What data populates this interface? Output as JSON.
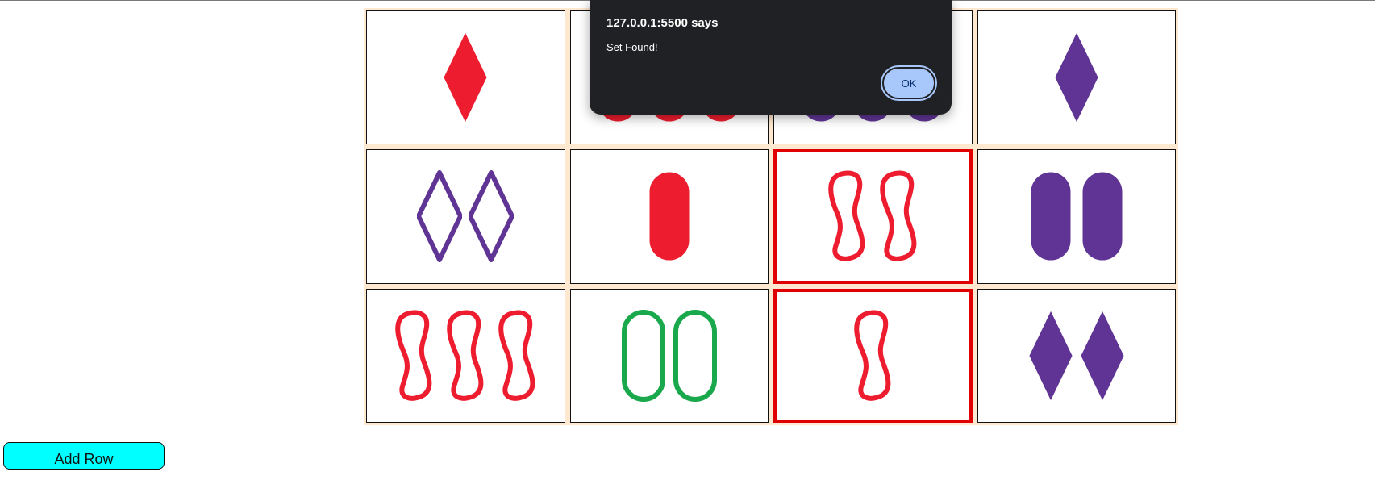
{
  "dialog": {
    "title": "127.0.0.1:5500 says",
    "message": "Set Found!",
    "ok_label": "OK"
  },
  "board": {
    "cards": [
      {
        "count": 1,
        "shape": "diamond",
        "color": "#ed1c2e",
        "fill": "solid",
        "selected": false
      },
      {
        "count": 3,
        "shape": "oval",
        "color": "#ed1c2e",
        "fill": "solid",
        "selected": false
      },
      {
        "count": 3,
        "shape": "oval",
        "color": "#5f3494",
        "fill": "solid",
        "selected": false
      },
      {
        "count": 1,
        "shape": "diamond",
        "color": "#5f3494",
        "fill": "solid",
        "selected": false
      },
      {
        "count": 2,
        "shape": "diamond",
        "color": "#5f3494",
        "fill": "outline",
        "selected": false
      },
      {
        "count": 1,
        "shape": "oval",
        "color": "#ed1c2e",
        "fill": "solid",
        "selected": false
      },
      {
        "count": 2,
        "shape": "squiggle",
        "color": "#ed1c2e",
        "fill": "outline",
        "selected": true
      },
      {
        "count": 2,
        "shape": "oval",
        "color": "#5f3494",
        "fill": "solid",
        "selected": false
      },
      {
        "count": 3,
        "shape": "squiggle",
        "color": "#ed1c2e",
        "fill": "outline",
        "selected": false
      },
      {
        "count": 2,
        "shape": "oval",
        "color": "#1aa84c",
        "fill": "outline",
        "selected": false
      },
      {
        "count": 1,
        "shape": "squiggle",
        "color": "#ed1c2e",
        "fill": "outline",
        "selected": true
      },
      {
        "count": 2,
        "shape": "diamond",
        "color": "#5f3494",
        "fill": "solid",
        "selected": false
      }
    ]
  },
  "controls": {
    "add_row_label": "Add Row",
    "add_row_color": "#00ffff"
  },
  "colors": {
    "board_background": "#ffe8d0",
    "selected_border": "#e00000"
  }
}
